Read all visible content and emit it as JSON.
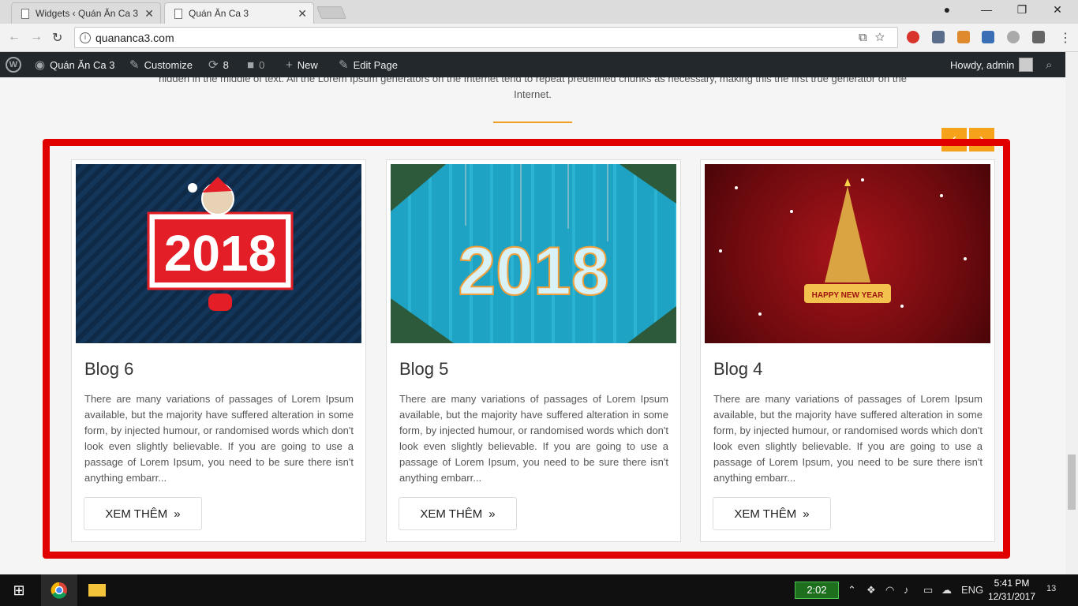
{
  "browser": {
    "tabs": [
      {
        "label": "Widgets ‹ Quán Ăn Ca 3"
      },
      {
        "label": "Quán Ăn Ca 3"
      }
    ],
    "url": "quananca3.com",
    "window_buttons": {
      "minimize": "—",
      "restore": "❐",
      "close": "✕"
    }
  },
  "adminbar": {
    "site": "Quán Ăn Ca 3",
    "customize": "Customize",
    "updates_count": "8",
    "comments_count": "0",
    "new": "New",
    "edit_page": "Edit Page",
    "howdy": "Howdy, admin"
  },
  "page": {
    "intro_text": "hidden in the middle of text. All the Lorem Ipsum generators on the Internet tend to repeat predefined chunks as necessary, making this the first true generator on the Internet.",
    "prev_arrow": "‹",
    "next_arrow": "›",
    "posts": [
      {
        "title": "Blog 6",
        "excerpt": "There are many variations of passages of Lorem Ipsum available, but the majority have suffered alteration in some form, by injected humour, or randomised words which don't look even slightly believable. If you are going to use a passage of Lorem Ipsum, you need to be sure there isn't anything embarr...",
        "button": "XEM THÊM",
        "image_text": "2018"
      },
      {
        "title": "Blog 5",
        "excerpt": "There are many variations of passages of Lorem Ipsum available, but the majority have suffered alteration in some form, by injected humour, or randomised words which don't look even slightly believable. If you are going to use a passage of Lorem Ipsum, you need to be sure there isn't anything embarr...",
        "button": "XEM THÊM",
        "image_text": "2018"
      },
      {
        "title": "Blog 4",
        "excerpt": "There are many variations of passages of Lorem Ipsum available, but the majority have suffered alteration in some form, by injected humour, or randomised words which don't look even slightly believable. If you are going to use a passage of Lorem Ipsum, you need to be sure there isn't anything embarr...",
        "button": "XEM THÊM",
        "image_text": "HAPPY NEW YEAR"
      }
    ]
  },
  "taskbar": {
    "battery_timer": "2:02",
    "language": "ENG",
    "time": "5:41 PM",
    "date": "12/31/2017",
    "notifications": "13"
  },
  "colors": {
    "highlight_frame": "#e10000",
    "accent": "#f7a21b",
    "adminbar": "#23282d"
  }
}
